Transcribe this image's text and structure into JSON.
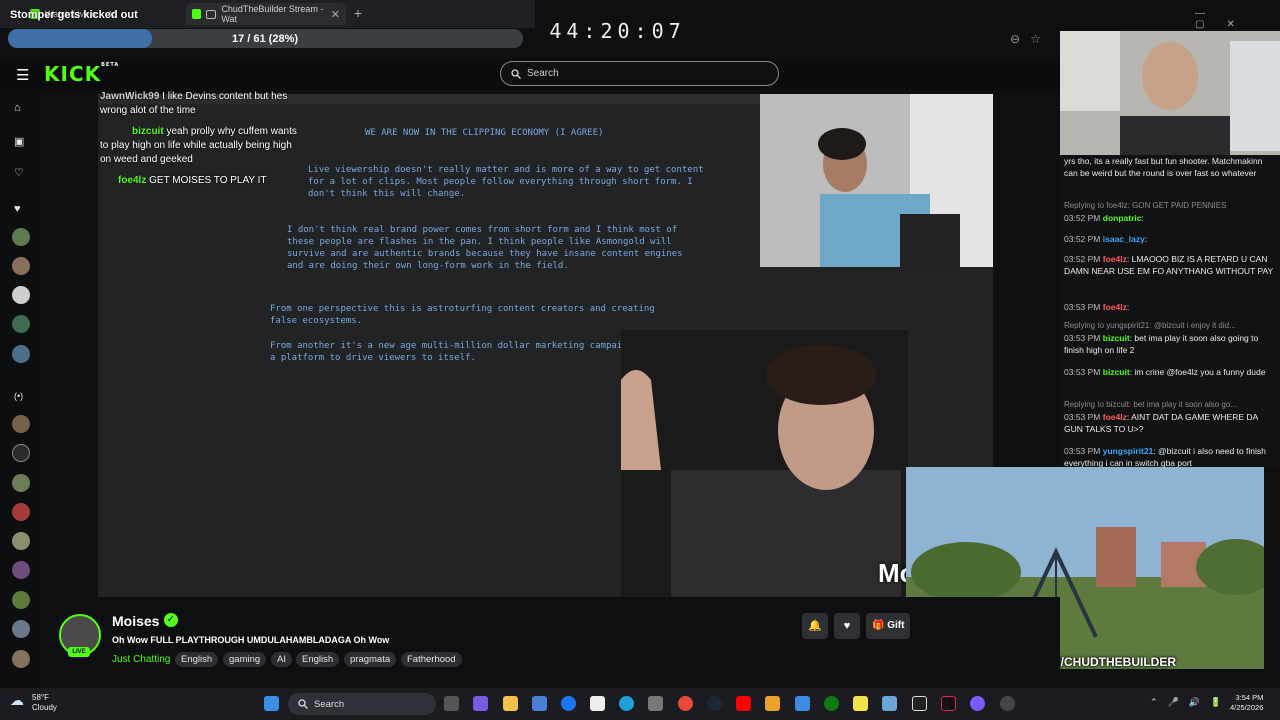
{
  "browser": {
    "tabs": [
      {
        "label": "Watch Live o"
      },
      {
        "label": "ChudTheBuilder Stream - Wat"
      }
    ],
    "new_tab": "+"
  },
  "overlay": {
    "title": "Stomper gets kicked out",
    "progress_text": "17 / 61 (28%)",
    "progress_fraction": 0.28,
    "timer": "44:20:07"
  },
  "kick": {
    "logo": "KICK",
    "logo_sup": "BETA",
    "search_placeholder": "Search"
  },
  "stream_chat_overlay": [
    {
      "user": "JawnWick99",
      "text": "I like Devins content but hes wrong alot of the time"
    },
    {
      "user": "bizcuit",
      "text": "yeah prolly why cuffem wants to play high on life while actually being high on weed and geeked"
    },
    {
      "user": "foe4lz",
      "text": "GET MOISES TO PLAY IT"
    }
  ],
  "drawing": {
    "heading": "WE ARE NOW IN THE CLIPPING ECONOMY (I AGREE)",
    "para1": "Live viewership doesn't really matter and is more of a way to get content for a lot of clips. Most people follow everything through short form. I don't think this will change.",
    "para2": "I don't think real brand power comes from short form and I think most of these people are flashes in the pan. I think people like Asmongold will survive and are authentic brands because they have insane content engines and are doing their own long-form work in the field.",
    "para3": "From one perspective this is astroturfing content creators and creating false ecosystems.",
    "para4": "From another it's a new age multi-million dollar marketing campaign from a platform to drive viewers to itself."
  },
  "side_chat": [
    {
      "kind": "text",
      "text": "yrs tho, its a really fast but fun shooter. Matchmakinn can be weird but the round is over fast so whatever"
    },
    {
      "kind": "reply",
      "text": "Replying to foe4lz: GON GET PAID PENNIES"
    },
    {
      "kind": "msg",
      "time": "03:52 PM",
      "user": "donpatric",
      "color": "#53fc18",
      "text": ""
    },
    {
      "kind": "msg",
      "time": "03:52 PM",
      "user": "isaac_lazy",
      "color": "#3fa7ff",
      "text": ""
    },
    {
      "kind": "msg",
      "time": "03:52 PM",
      "user": "foe4lz",
      "color": "#ff5c5c",
      "text": "LMAOOO BIZ IS A RETARD U CAN DAMN NEAR USE EM FO ANYTHANG WITHOUT PAY"
    },
    {
      "kind": "msg",
      "time": "03:53 PM",
      "user": "foe4lz",
      "color": "#ff5c5c",
      "text": ""
    },
    {
      "kind": "reply",
      "text": "Replying to yungspirit21: @bizcuit i enjoy it did..."
    },
    {
      "kind": "msg",
      "time": "03:53 PM",
      "user": "bizcuit",
      "color": "#53fc18",
      "text": "bet ima play it soon also going to finish high on life 2"
    },
    {
      "kind": "msg",
      "time": "03:53 PM",
      "user": "bizcuit",
      "color": "#53fc18",
      "text": "im crine @foe4lz you a funny dude"
    },
    {
      "kind": "reply",
      "text": "Replying to bizcuit: bet ima play it soon also go..."
    },
    {
      "kind": "msg",
      "time": "03:53 PM",
      "user": "foe4lz",
      "color": "#ff5c5c",
      "text": "AINT DAT DA GAME WHERE DA GUN TALKS TO U>?"
    },
    {
      "kind": "msg",
      "time": "03:53 PM",
      "user": "yungspirit21",
      "color": "#3fa7ff",
      "text": "@bizcuit i also need to finish everything i can in switch gba port"
    }
  ],
  "pip_url": "KICK.COM/CHUDTHEBUILDER",
  "webcam_overlay_text": "Mo",
  "channel": {
    "name": "Moises",
    "live_badge": "LIVE",
    "title": "Oh Wow FULL PLAYTHROUGH UMDULAHAMBLADAGA Oh Wow",
    "category": "Just Chatting",
    "tags": [
      "English",
      "gaming",
      "AI",
      "English",
      "pragmata",
      "Fatherhood"
    ],
    "gift_label": "Gift"
  },
  "taskbar": {
    "weather_temp": "58°F",
    "weather_desc": "Cloudy",
    "search_label": "Search",
    "time": "3:54 PM",
    "date": "4/25/2026"
  }
}
